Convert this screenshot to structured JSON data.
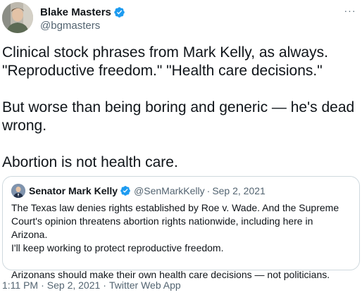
{
  "tweet": {
    "author": {
      "display_name": "Blake Masters",
      "handle": "@bgmasters",
      "verified_icon": "verified-badge-icon"
    },
    "more_icon": "more-horizontal-icon",
    "more_label": "···",
    "body": {
      "p1_line1": "Clinical stock phrases from Mark Kelly, as always.",
      "p1_line2": "\"Reproductive freedom.\" \"Health care decisions.\"",
      "p2_line1": "But worse than being boring and generic — he's dead",
      "p2_line2": "wrong.",
      "p3": "Abortion is not health care."
    },
    "quoted_tweet": {
      "display_name": "Senator Mark Kelly",
      "handle": "@SenMarkKelly",
      "separator": "·",
      "date": "Sep 2, 2021",
      "line1": "The Texas law denies rights established by Roe v. Wade. And the Supreme",
      "line2": "Court's opinion threatens abortion rights nationwide, including here in Arizona.",
      "line3": "I'll keep working to protect reproductive freedom.",
      "line4": "Arizonans should make their own health care decisions — not politicians."
    },
    "meta": {
      "time": "1:11 PM",
      "separator": "·",
      "date": "Sep 2, 2021",
      "source": "Twitter Web App"
    },
    "colors": {
      "text": "#0f1419",
      "secondary": "#536471",
      "verified": "#1d9bf0",
      "border": "#cfd9de"
    }
  }
}
